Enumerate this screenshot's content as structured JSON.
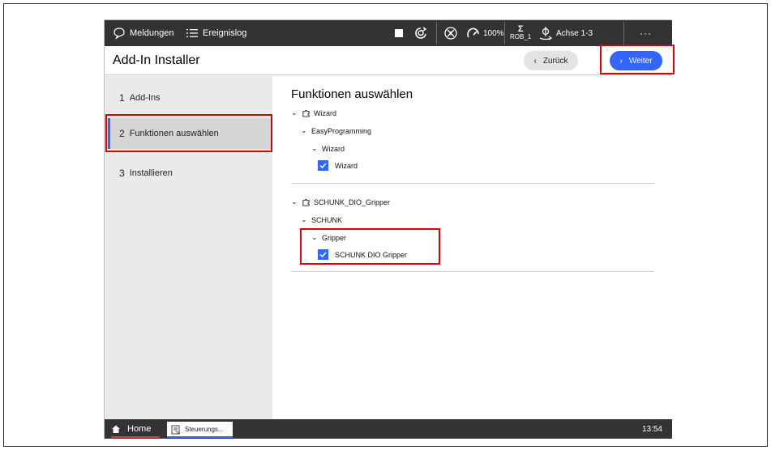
{
  "topbar": {
    "messages_label": "Meldungen",
    "eventlog_label": "Ereignislog",
    "speed_label": "100%",
    "robot_label": "ROB_1",
    "axes_label": "Achse 1-3",
    "more_label": "···"
  },
  "header": {
    "title": "Add-In Installer",
    "back_label": "Zurück",
    "next_label": "Weiter"
  },
  "sidebar": {
    "steps": [
      {
        "num": "1",
        "label": "Add-Ins",
        "active": false
      },
      {
        "num": "2",
        "label": "Funktionen auswählen",
        "active": true
      },
      {
        "num": "3",
        "label": "Installieren",
        "active": false
      }
    ]
  },
  "main": {
    "title": "Funktionen auswählen",
    "group1": {
      "package": "Wizard",
      "category": "EasyProgramming",
      "subcategory": "Wizard",
      "item": "Wizard",
      "checked": true
    },
    "group2": {
      "package": "SCHUNK_DIO_Gripper",
      "category": "SCHUNK",
      "subcategory": "Gripper",
      "item": "SCHUNK DIO Gripper",
      "checked": true
    }
  },
  "taskbar": {
    "home_label": "Home",
    "task_label": "Steuerungs...",
    "clock": "13:54"
  },
  "colors": {
    "accent": "#3366ff",
    "highlight": "#e00000",
    "bar": "#333333"
  }
}
